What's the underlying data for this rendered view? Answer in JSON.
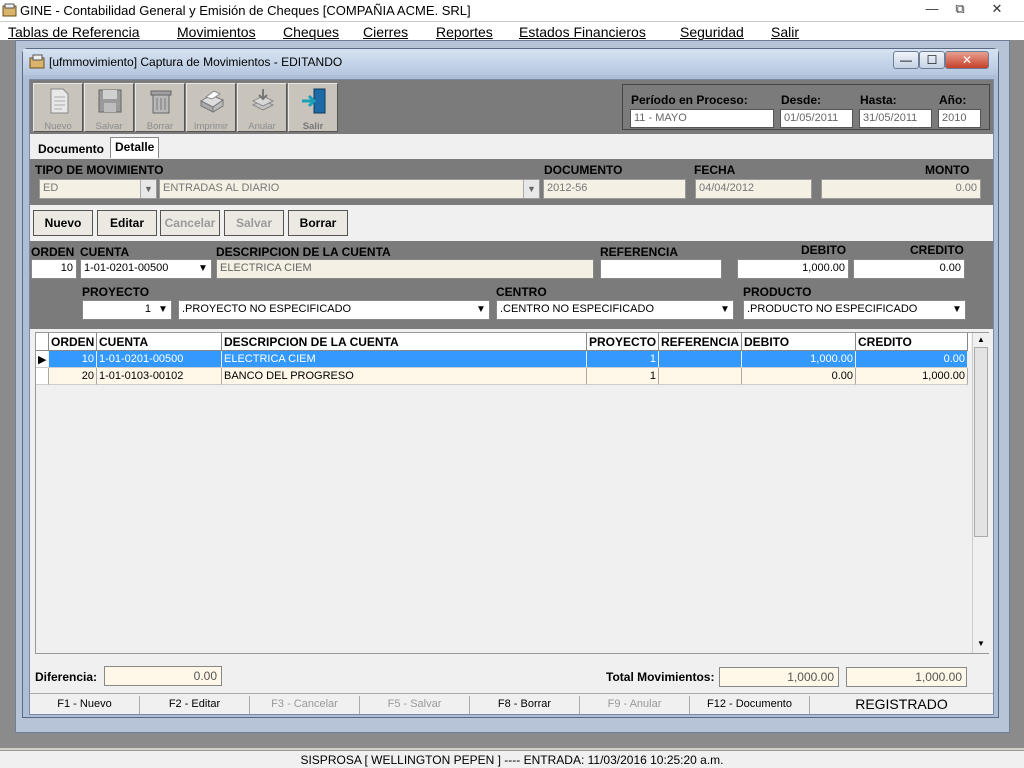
{
  "app": {
    "title": "GINE - Contabilidad General y Emisión de Cheques [COMPAÑIA ACME. SRL]",
    "window_buttons": {
      "minimize": "—",
      "restore": "⧉",
      "close": "✕"
    }
  },
  "menubar": {
    "items": [
      {
        "label": "Tablas de Referencia"
      },
      {
        "label": "Movimientos"
      },
      {
        "label": "Cheques"
      },
      {
        "label": "Cierres"
      },
      {
        "label": "Reportes"
      },
      {
        "label": "Estados Financieros"
      },
      {
        "label": "Seguridad"
      },
      {
        "label": "Salir"
      }
    ]
  },
  "window": {
    "title": "[ufmmovimiento] Captura de Movimientos - EDITANDO",
    "buttons": {
      "minimize": "—",
      "maximize": "☐",
      "close": "✕"
    }
  },
  "toolbar": {
    "buttons": [
      {
        "label": "Nuevo",
        "icon": "document-icon"
      },
      {
        "label": "Salvar",
        "icon": "floppy-icon"
      },
      {
        "label": "Borrar",
        "icon": "trash-icon"
      },
      {
        "label": "Imprimir",
        "icon": "printer-icon"
      },
      {
        "label": "Anular",
        "icon": "void-icon"
      },
      {
        "label": "Salir",
        "icon": "exit-icon"
      }
    ]
  },
  "period": {
    "label": "Período en Proceso:",
    "value": "11 - MAYO",
    "desde_label": "Desde:",
    "desde": "01/05/2011",
    "hasta_label": "Hasta:",
    "hasta": "31/05/2011",
    "anio_label": "Año:",
    "anio": "2010"
  },
  "tabs": [
    {
      "label": "Documento"
    },
    {
      "label": "Detalle"
    }
  ],
  "header": {
    "tipo_label": "TIPO DE MOVIMIENTO",
    "tipo_code": "ED",
    "tipo_desc": "ENTRADAS AL DIARIO",
    "documento_label": "DOCUMENTO",
    "documento": "2012-56",
    "fecha_label": "FECHA",
    "fecha": "04/04/2012",
    "monto_label": "MONTO",
    "monto": "0.00"
  },
  "actions": {
    "nuevo": "Nuevo",
    "editar": "Editar",
    "cancelar": "Cancelar",
    "salvar": "Salvar",
    "borrar": "Borrar"
  },
  "edit": {
    "orden_label": "ORDEN",
    "orden": "10",
    "cuenta_label": "CUENTA",
    "cuenta": "1-01-0201-00500",
    "desc_label": "DESCRIPCION DE LA CUENTA",
    "desc": "ELECTRICA CIEM",
    "ref_label": "REFERENCIA",
    "ref": "",
    "debito_label": "DEBITO",
    "debito": "1,000.00",
    "credito_label": "CREDITO",
    "credito": "0.00",
    "proyecto_label": "PROYECTO",
    "proyecto_num": "1",
    "proyecto": ".PROYECTO NO ESPECIFICADO",
    "centro_label": "CENTRO",
    "centro": ".CENTRO NO ESPECIFICADO",
    "producto_label": "PRODUCTO",
    "producto": ".PRODUCTO NO ESPECIFICADO"
  },
  "grid": {
    "columns": [
      "ORDEN",
      "CUENTA",
      "DESCRIPCION DE LA CUENTA",
      "PROYECTO",
      "REFERENCIA",
      "DEBITO",
      "CREDITO"
    ],
    "rows": [
      {
        "orden": "10",
        "cuenta": "1-01-0201-00500",
        "desc": "ELECTRICA CIEM",
        "proyecto": "1",
        "ref": "",
        "debito": "1,000.00",
        "credito": "0.00"
      },
      {
        "orden": "20",
        "cuenta": "1-01-0103-00102",
        "desc": "BANCO DEL PROGRESO",
        "proyecto": "1",
        "ref": "",
        "debito": "0.00",
        "credito": "1,000.00"
      }
    ]
  },
  "footer": {
    "diferencia_label": "Diferencia:",
    "diferencia": "0.00",
    "total_label": "Total Movimientos:",
    "total_debito": "1,000.00",
    "total_credito": "1,000.00"
  },
  "fkeys": [
    {
      "label": "F1 - Nuevo"
    },
    {
      "label": "F2 - Editar"
    },
    {
      "label": "F3 - Cancelar"
    },
    {
      "label": "F5 - Salvar"
    },
    {
      "label": "F8 - Borrar"
    },
    {
      "label": "F9 - Anular"
    },
    {
      "label": "F12 - Documento"
    }
  ],
  "status": "REGISTRADO",
  "statusbar": "SISPROSA [ WELLINGTON PEPEN ] ---- ENTRADA: 11/03/2016 10:25:20 a.m."
}
